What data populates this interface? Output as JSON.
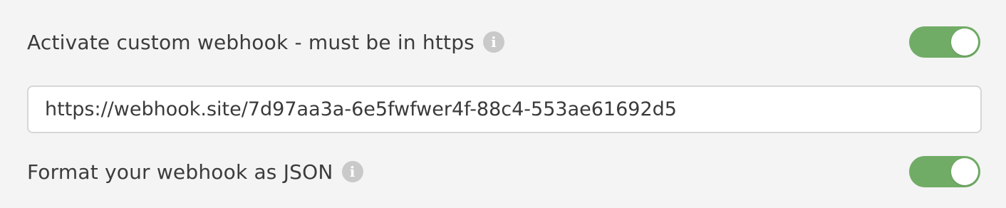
{
  "webhook": {
    "activate_label": "Activate custom webhook - must be in https",
    "activate_info_icon": "info-icon",
    "activate_enabled": true,
    "url_value": "https://webhook.site/7d97aa3a-6e5fwfwer4f-88c4-553ae61692d5",
    "json_label": "Format your webhook as JSON",
    "json_info_icon": "info-icon",
    "json_enabled": true
  },
  "colors": {
    "toggle_on": "#71ac66",
    "background": "#f4f4f4",
    "info_icon": "#c9c9c9"
  },
  "icons": {
    "info_glyph": "i"
  }
}
